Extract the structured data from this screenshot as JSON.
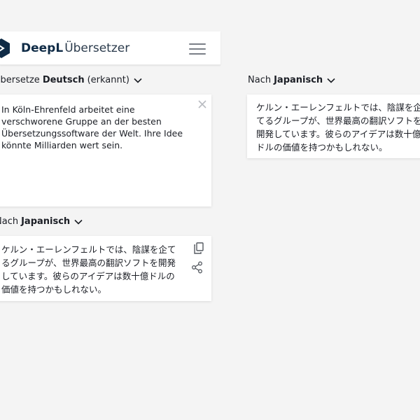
{
  "header": {
    "brand_bold": "DeepL",
    "brand_light": "Übersetzer"
  },
  "icons": {
    "logo": "deepl-logo-icon",
    "menu": "hamburger-menu-icon",
    "close": "close-icon",
    "copy": "copy-icon",
    "share": "share-icon",
    "chevron": "chevron-down-icon"
  },
  "source": {
    "prefix": "Übersetze",
    "language": "Deutsch",
    "suffix": "(erkannt)",
    "text": "In Köln-Ehrenfeld arbeitet eine verschworene Gruppe an der besten Übersetzungssoftware der Welt. Ihre Idee könnte Milliarden wert sein."
  },
  "target_mobile": {
    "prefix": "Nach",
    "language": "Japanisch",
    "text": "ケルン・エーレンフェルトでは、陰謀を企てるグループが、世界最高の翻訳ソフトを開発しています。彼らのアイデアは数十億ドルの価値を持つかもしれない。"
  },
  "target_desktop": {
    "prefix": "Nach",
    "language": "Japanisch",
    "text": "ケルン・エーレンフェルトでは、陰謀を企てるグループが、世界最高の翻訳ソフトを開発しています。彼らのアイデアは数十億ドルの価値を持つかもしれない。"
  },
  "colors": {
    "page_bg": "#f4f4f4",
    "card_bg": "#ffffff",
    "brand": "#0f2b46",
    "text": "#1b1e25",
    "icon": "#7a7f87"
  }
}
